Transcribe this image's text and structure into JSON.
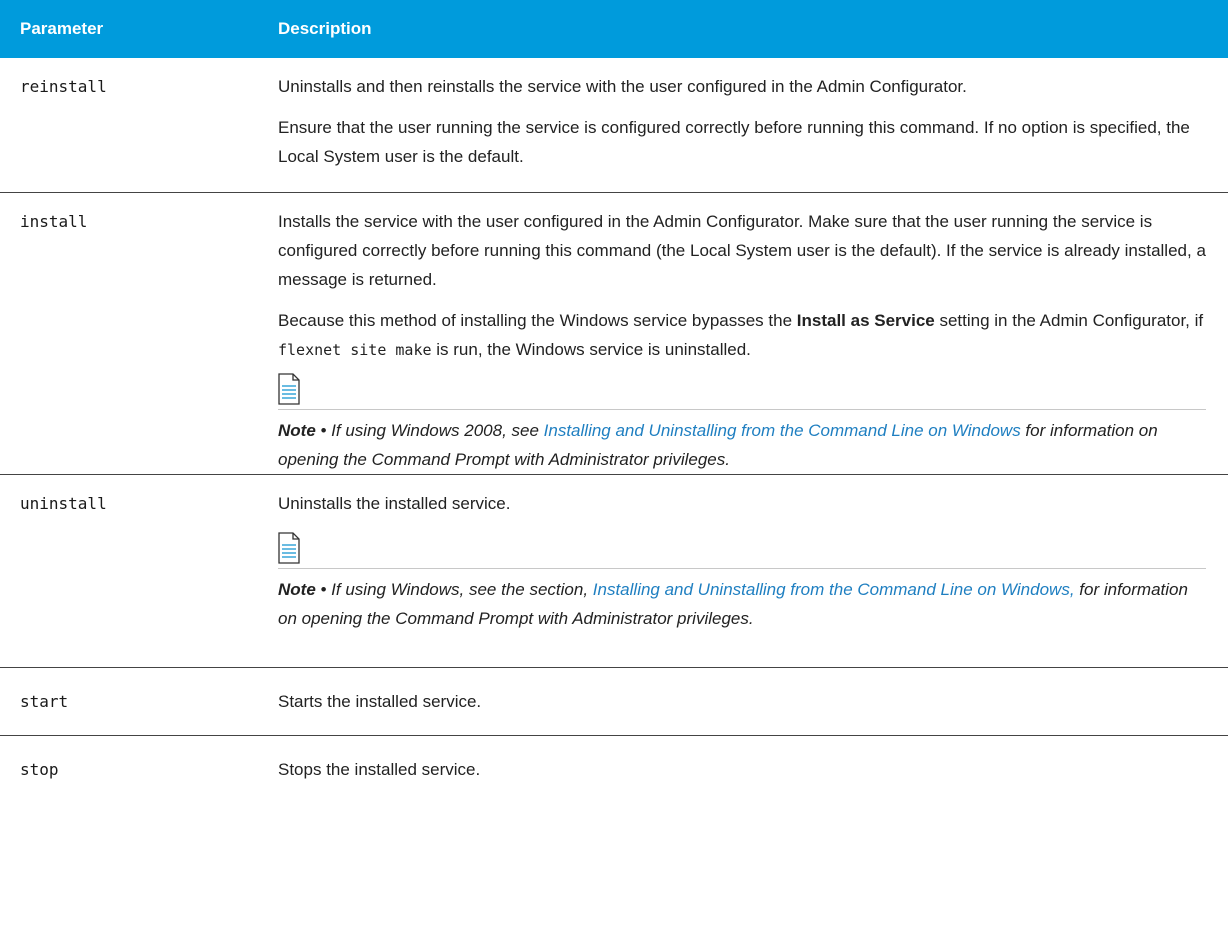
{
  "table": {
    "header": {
      "param": "Parameter",
      "desc": "Description"
    },
    "rows": [
      {
        "param": "reinstall",
        "p1": "Uninstalls and then reinstalls the service with the user configured in the Admin Configurator.",
        "p2": "Ensure that the user running the service is configured correctly before running this command. If no option is specified, the Local System user is the default."
      },
      {
        "param": "install",
        "p1": "Installs the service with the user configured in the Admin Configurator. Make sure that the user running the service is configured correctly before running this command (the Local System user is the default). If the service is already installed, a message is returned.",
        "p2a": "Because this method of installing the Windows service bypasses the ",
        "p2bold": "Install as Service",
        "p2b": " setting in the Admin Configurator, if ",
        "p2code": "flexnet site make",
        "p2c": " is run, the Windows service is uninstalled.",
        "note_label": "Note",
        "note_a": " • If using Windows 2008, see ",
        "note_link": "Installing and Uninstalling from the Command Line on Windows",
        "note_b": " for information on opening the Command Prompt with Administrator privileges."
      },
      {
        "param": "uninstall",
        "p1": "Uninstalls the installed service.",
        "note_label": "Note",
        "note_a": " • If using Windows, see the section, ",
        "note_link": "Installing and Uninstalling from the Command Line on Windows,",
        "note_b": " for information on opening the Command Prompt with Administrator privileges."
      },
      {
        "param": "start",
        "p1": "Starts the installed service."
      },
      {
        "param": "stop",
        "p1": "Stops the installed service."
      }
    ]
  },
  "colors": {
    "header_bg": "#009bdc",
    "link": "#1f7fc1"
  },
  "icons": {
    "note": "note-document-icon"
  }
}
